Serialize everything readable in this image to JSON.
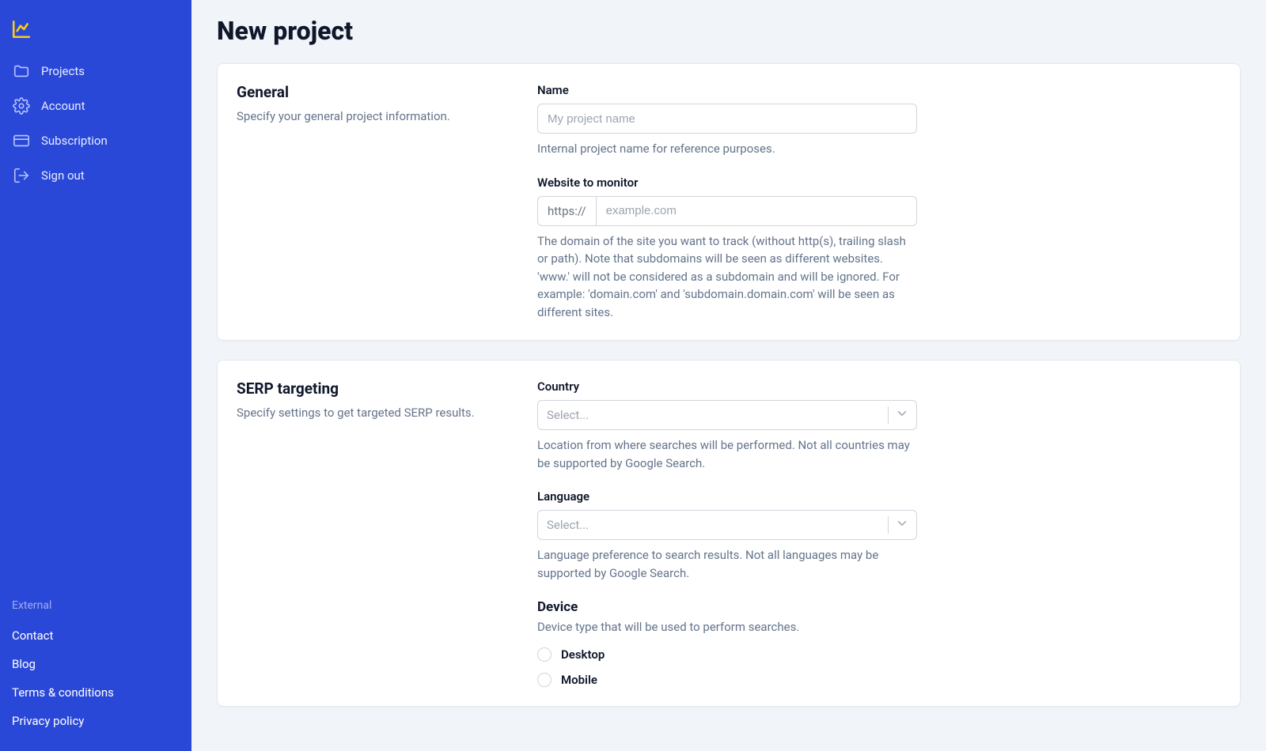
{
  "sidebar": {
    "nav": [
      {
        "id": "projects",
        "label": "Projects"
      },
      {
        "id": "account",
        "label": "Account"
      },
      {
        "id": "subscription",
        "label": "Subscription"
      },
      {
        "id": "signout",
        "label": "Sign out"
      }
    ],
    "external_heading": "External",
    "external_links": [
      {
        "id": "contact",
        "label": "Contact"
      },
      {
        "id": "blog",
        "label": "Blog"
      },
      {
        "id": "terms",
        "label": "Terms & conditions"
      },
      {
        "id": "privacy",
        "label": "Privacy policy"
      }
    ]
  },
  "page": {
    "title": "New project"
  },
  "general": {
    "heading": "General",
    "subheading": "Specify your general project information.",
    "name_label": "Name",
    "name_placeholder": "My project name",
    "name_help": "Internal project name for reference purposes.",
    "website_label": "Website to monitor",
    "website_protocol": "https://",
    "website_placeholder": "example.com",
    "website_help": "The domain of the site you want to track (without http(s), trailing slash or path). Note that subdomains will be seen as different websites. 'www.' will not be considered as a subdomain and will be ignored. For example: 'domain.com' and 'subdomain.domain.com' will be seen as different sites."
  },
  "serp": {
    "heading": "SERP targeting",
    "subheading": "Specify settings to get targeted SERP results.",
    "country_label": "Country",
    "country_placeholder": "Select...",
    "country_help": "Location from where searches will be performed. Not all countries may be supported by Google Search.",
    "language_label": "Language",
    "language_placeholder": "Select...",
    "language_help": "Language preference to search results. Not all languages may be supported by Google Search.",
    "device_heading": "Device",
    "device_help": "Device type that will be used to perform searches.",
    "device_options": [
      {
        "id": "desktop",
        "label": "Desktop"
      },
      {
        "id": "mobile",
        "label": "Mobile"
      }
    ]
  }
}
